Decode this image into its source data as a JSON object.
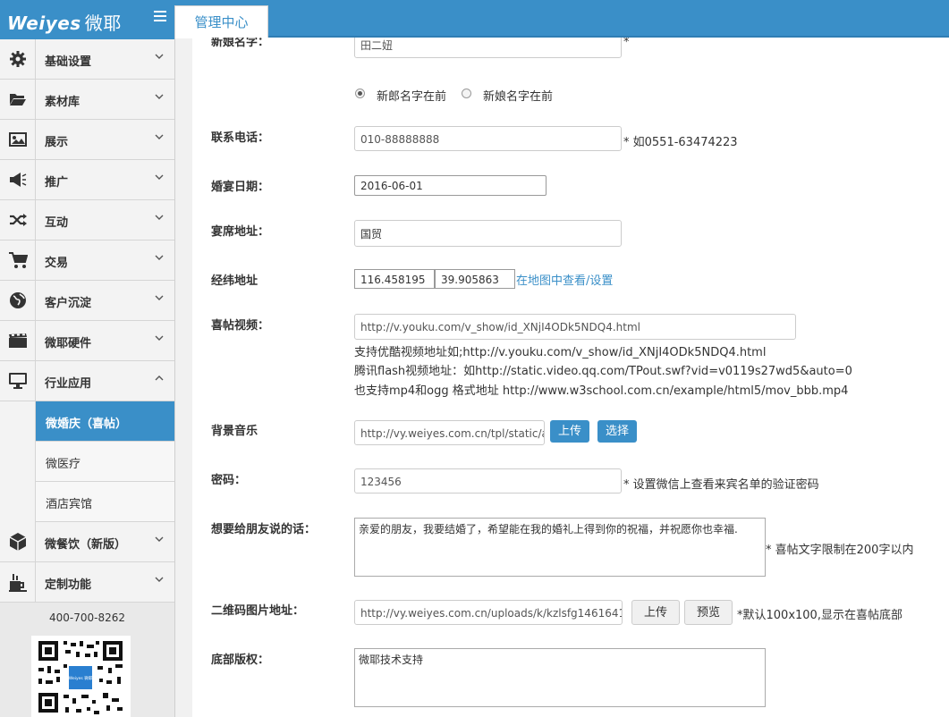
{
  "brand": {
    "logo_en": "Weiyes",
    "logo_cn": "微耶"
  },
  "topbar": {
    "tab_label": "管理中心"
  },
  "sidebar": {
    "menu": [
      {
        "label": "基础设置",
        "icon": "gear-icon"
      },
      {
        "label": "素材库",
        "icon": "folder-open-icon"
      },
      {
        "label": "展示",
        "icon": "picture-icon"
      },
      {
        "label": "推广",
        "icon": "megaphone-icon"
      },
      {
        "label": "互动",
        "icon": "shuffle-icon"
      },
      {
        "label": "交易",
        "icon": "cart-icon"
      },
      {
        "label": "客户沉淀",
        "icon": "globe-icon"
      },
      {
        "label": "微耶硬件",
        "icon": "film-icon"
      },
      {
        "label": "行业应用",
        "icon": "monitor-icon"
      }
    ],
    "sub_items": [
      {
        "label": "微婚庆（喜帖）",
        "active": true
      },
      {
        "label": "微医疗",
        "active": false
      },
      {
        "label": "酒店宾馆",
        "active": false
      }
    ],
    "menu_after": [
      {
        "label": "微餐饮（新版）",
        "icon": "cube-icon"
      },
      {
        "label": "定制功能",
        "icon": "cup-icon"
      }
    ],
    "phone": "400-700-8262",
    "qr_badge": "Weiyes 微耶"
  },
  "form": {
    "bride_name": {
      "label": "新娘名字：",
      "value": "田二妞",
      "required": "*"
    },
    "order_options": [
      "新郎名字在前",
      "新娘名字在前"
    ],
    "phone": {
      "label": "联系电话：",
      "value": "010-88888888",
      "note": "* 如0551-63474223"
    },
    "date": {
      "label": "婚宴日期：",
      "value": "2016-06-01"
    },
    "address": {
      "label": "宴席地址：",
      "value": "国贸"
    },
    "coords": {
      "label": "经纬地址",
      "lng": "116.458195",
      "lat": "39.905863",
      "link": "在地图中查看/设置"
    },
    "video": {
      "label": "喜帖视频：",
      "value": "http://v.youku.com/v_show/id_XNjI4ODk5NDQ4.html",
      "help": [
        "支持优酷视频地址如;http://v.youku.com/v_show/id_XNjI4ODk5NDQ4.html",
        "腾讯flash视频地址：如http://static.video.qq.com/TPout.swf?vid=v0119s27wd5&auto=0",
        "也支持mp4和ogg 格式地址 http://www.w3school.com.cn/example/html5/mov_bbb.mp4"
      ]
    },
    "music": {
      "label": "背景音乐",
      "value": "http://vy.weiyes.com.cn/tpl/static/a",
      "upload": "上传",
      "select": "选择"
    },
    "password": {
      "label": "密码：",
      "value": "123456",
      "note": "* 设置微信上查看来宾名单的验证密码"
    },
    "message": {
      "label": "想要给朋友说的话：",
      "value": "亲爱的朋友，我要结婚了，希望能在我的婚礼上得到你的祝福，并祝愿你也幸福.",
      "note": "* 喜帖文字限制在200字以内"
    },
    "qrcode": {
      "label": "二维码图片地址：",
      "value": "http://vy.weiyes.com.cn/uploads/k/kzlsfg1461641",
      "upload": "上传",
      "preview": "预览",
      "note": "*默认100x100,显示在喜帖底部"
    },
    "copyright": {
      "label": "底部版权：",
      "value": "微耶技术支持"
    }
  }
}
